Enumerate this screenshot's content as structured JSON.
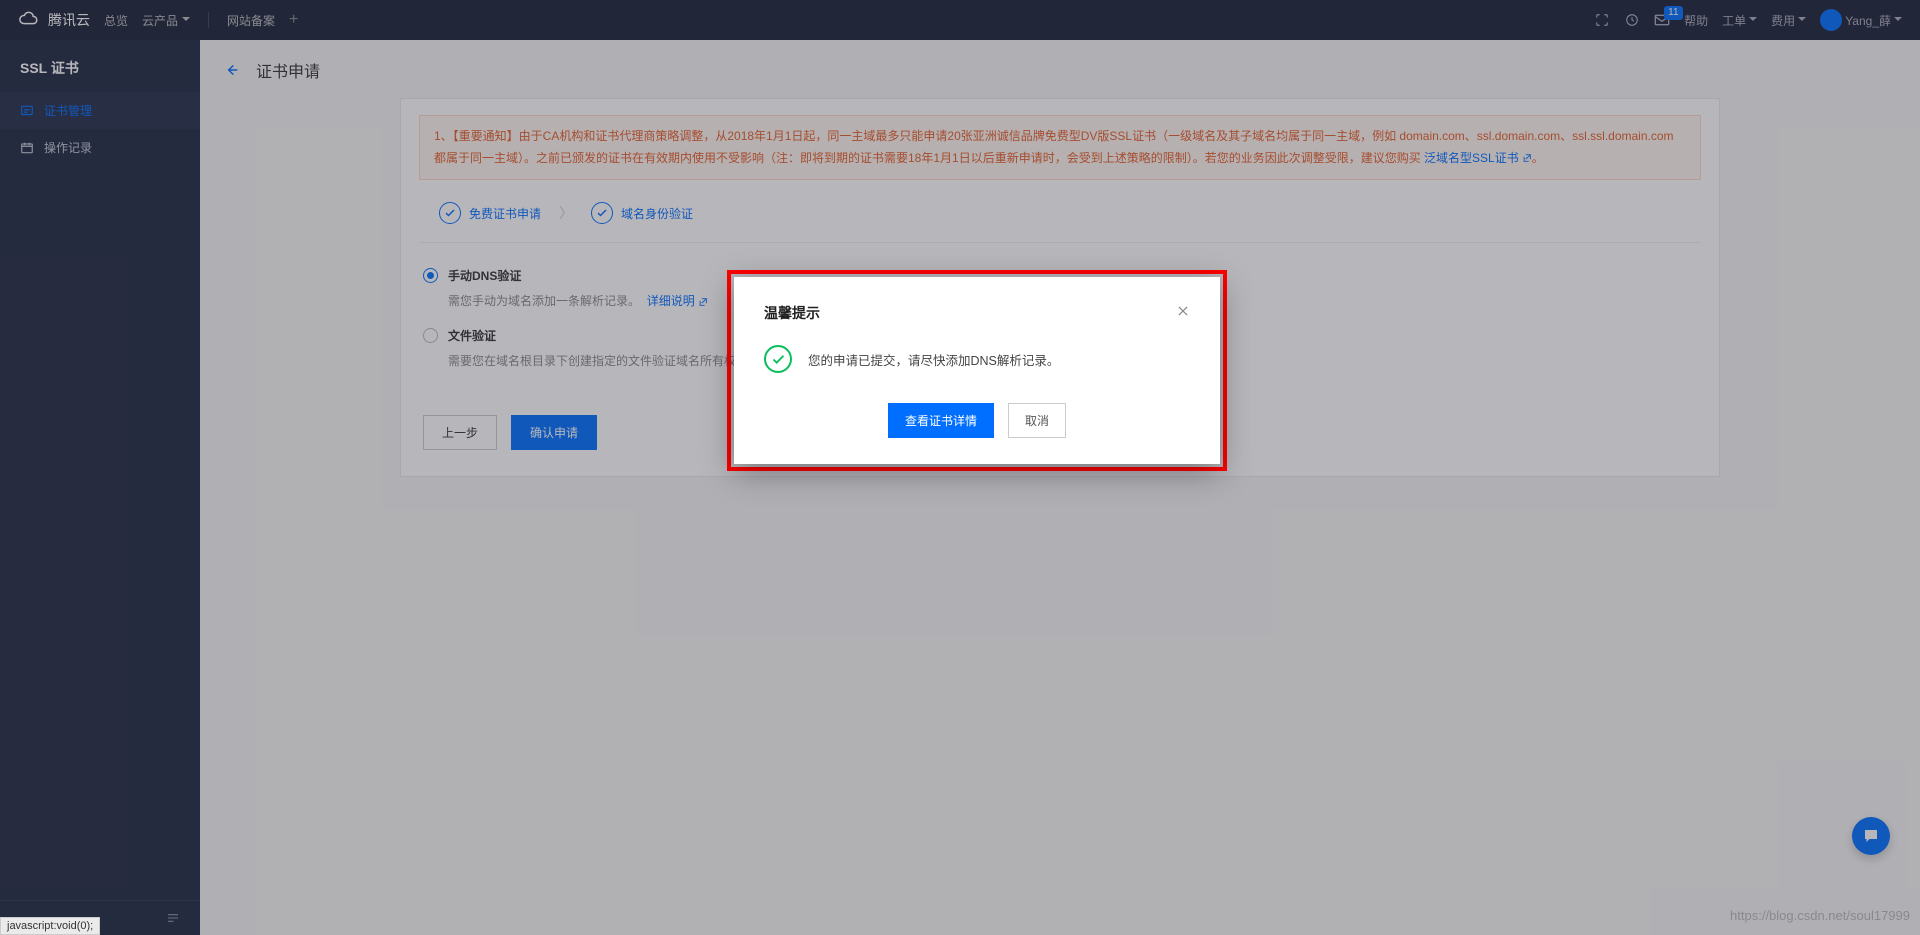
{
  "brand": "腾讯云",
  "topnav": {
    "overview": "总览",
    "products": "云产品",
    "beian": "网站备案"
  },
  "header": {
    "badge": "11",
    "help": "帮助",
    "workorder": "工单",
    "billing": "费用",
    "username": "Yang_薛"
  },
  "sidebar": {
    "title": "SSL 证书",
    "certmgmt": "证书管理",
    "oplog": "操作记录"
  },
  "page": {
    "title": "证书申请"
  },
  "notice": {
    "text_before": "1、【重要通知】由于CA机构和证书代理商策略调整，从2018年1月1日起，同一主域最多只能申请20张亚洲诚信品牌免费型DV版SSL证书（一级域名及其子域名均属于同一主域，例如 domain.com、ssl.domain.com、ssl.ssl.domain.com 都属于同一主域）。之前已颁发的证书在有效期内使用不受影响（注：即将到期的证书需要18年1月1日以后重新申请时，会受到上述策略的限制）。若您的业务因此次调整受限，建议您购买",
    "link": "泛域名型SSL证书",
    "after": "。"
  },
  "steps": {
    "free": "免费证书申请",
    "domain": "域名身份验证"
  },
  "options": {
    "dns": {
      "title": "手动DNS验证",
      "sub": "需您手动为域名添加一条解析记录。",
      "link": "详细说明"
    },
    "file": {
      "title": "文件验证",
      "sub": "需要您在域名根目录下创建指定的文件验证域名所有权。"
    }
  },
  "buttons": {
    "prev": "上一步",
    "confirm": "确认申请"
  },
  "modal": {
    "title": "温馨提示",
    "text": "您的申请已提交，请尽快添加DNS解析记录。",
    "view": "查看证书详情",
    "cancel": "取消"
  },
  "watermark": "https://blog.csdn.net/soul17999",
  "status": "javascript:void(0);"
}
